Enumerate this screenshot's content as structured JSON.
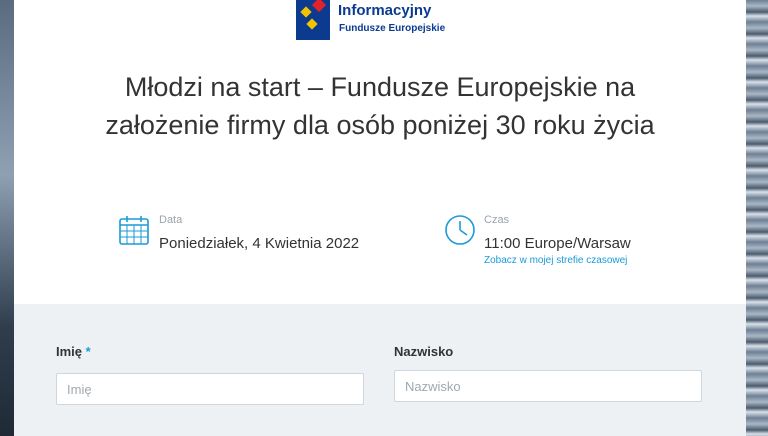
{
  "logo": {
    "title": "Informacyjny",
    "subtitle": "Fundusze Europejskie"
  },
  "event": {
    "title": "Młodzi na start – Fundusze Europejskie na założenie firmy dla osób poniżej 30 roku życia"
  },
  "meta": {
    "date_label": "Data",
    "date_value": "Poniedziałek, 4 Kwietnia 2022",
    "time_label": "Czas",
    "time_value": "11:00 Europe/Warsaw",
    "timezone_link": "Zobacz w mojej strefie czasowej"
  },
  "form": {
    "first_name_label": "Imię",
    "first_name_required": "*",
    "first_name_placeholder": "Imię",
    "last_name_label": "Nazwisko",
    "last_name_placeholder": "Nazwisko"
  },
  "colors": {
    "accent": "#1a9bd7",
    "brand_blue": "#0b3a8f",
    "form_bg": "#eef1f4"
  }
}
